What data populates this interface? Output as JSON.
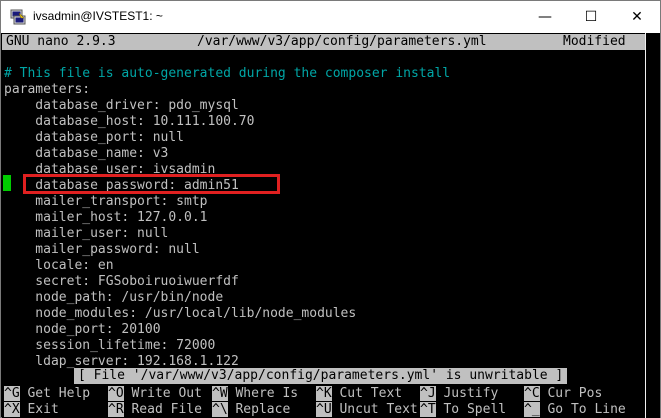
{
  "window": {
    "title": "ivsadmin@IVSTEST1: ~",
    "minimize_glyph": "—",
    "maximize_glyph": "☐",
    "close_glyph": "✕"
  },
  "nano": {
    "version": "GNU nano 2.9.3",
    "filename": "/var/www/v3/app/config/parameters.yml",
    "modified": "Modified"
  },
  "file_lines": [
    "# This file is auto-generated during the composer install",
    "parameters:",
    "    database_driver: pdo_mysql",
    "    database_host: 10.111.100.70",
    "    database_port: null",
    "    database_name: v3",
    "    database_user: ivsadmin",
    "    database_password: admin51",
    "    mailer_transport: smtp",
    "    mailer_host: 127.0.0.1",
    "    mailer_user: null",
    "    mailer_password: null",
    "    locale: en",
    "    secret: FGSoboiruoiwuerfdf",
    "    node_path: /usr/bin/node",
    "    node_modules: /usr/local/lib/node_modules",
    "    node_port: 20100",
    "    session_lifetime: 72000",
    "    ldap_server: 192.168.1.122"
  ],
  "status_message": "[ File '/var/www/v3/app/config/parameters.yml' is unwritable ]",
  "shortcuts_row1": [
    {
      "key": "^G",
      "label": "Get Help"
    },
    {
      "key": "^O",
      "label": "Write Out"
    },
    {
      "key": "^W",
      "label": "Where Is"
    },
    {
      "key": "^K",
      "label": "Cut Text"
    },
    {
      "key": "^J",
      "label": "Justify"
    },
    {
      "key": "^C",
      "label": "Cur Pos"
    }
  ],
  "shortcuts_row2": [
    {
      "key": "^X",
      "label": "Exit"
    },
    {
      "key": "^R",
      "label": "Read File"
    },
    {
      "key": "^\\",
      "label": "Replace"
    },
    {
      "key": "^U",
      "label": "Uncut Text"
    },
    {
      "key": "^T",
      "label": "To Spell"
    },
    {
      "key": "^_",
      "label": "Go To Line"
    }
  ],
  "colors": {
    "comment": "#00a6a6",
    "text": "#c0c0c0",
    "highlight": "#e02020",
    "cursor": "#00cc00"
  }
}
